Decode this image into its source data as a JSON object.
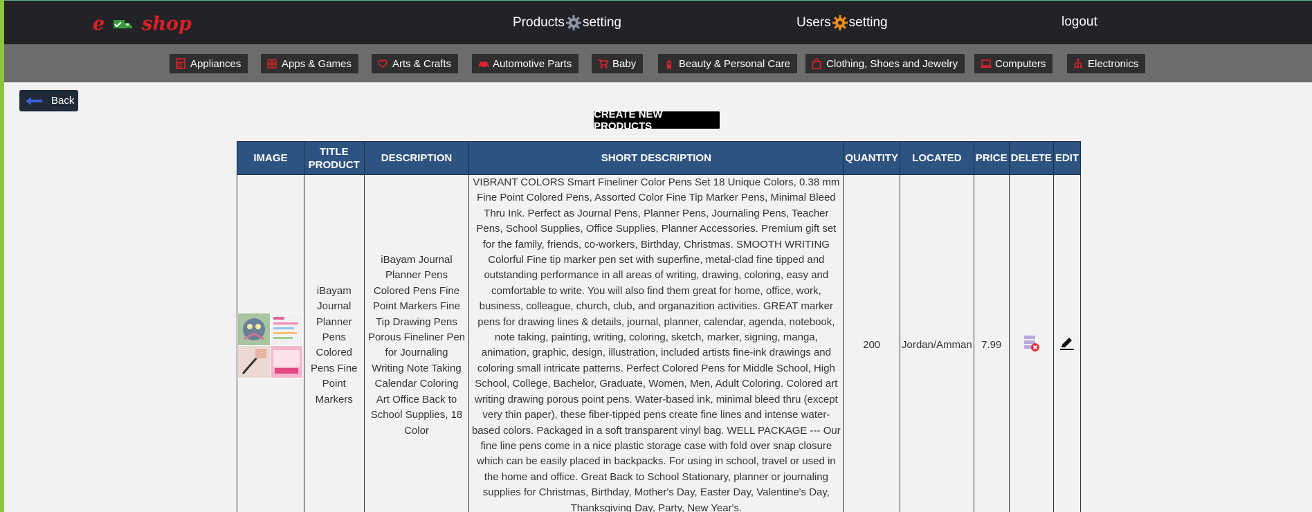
{
  "brand": {
    "left": "e",
    "right": "shop"
  },
  "nav": {
    "products_label_a": "Products",
    "products_label_b": "setting",
    "users_label_a": "Users",
    "users_label_b": "setting",
    "logout_label": "logout"
  },
  "categories": [
    {
      "label": "Appliances",
      "icon": "appliance-icon"
    },
    {
      "label": "Apps & Games",
      "icon": "apps-icon"
    },
    {
      "label": "Arts & Crafts",
      "icon": "heart-hand-icon"
    },
    {
      "label": "Automotive Parts",
      "icon": "car-icon"
    },
    {
      "label": "Baby",
      "icon": "stroller-icon"
    },
    {
      "label": "Beauty & Personal Care",
      "icon": "lipstick-icon"
    },
    {
      "label": "Clothing, Shoes and Jewelry",
      "icon": "bag-icon"
    },
    {
      "label": "Computers",
      "icon": "laptop-icon"
    },
    {
      "label": "Electronics",
      "icon": "circuit-icon"
    }
  ],
  "back_label": "Back",
  "create_title": "CREATE NEW PRODUCTS",
  "table": {
    "headers": {
      "image": "IMAGE",
      "title_a": "TITLE",
      "title_b": "PRODUCT",
      "description": "DESCRIPTION",
      "short_description": "SHORT DESCRIPTION",
      "quantity": "QUANTITY",
      "located": "LOCATED",
      "price": "PRICE",
      "delete": "DELETE",
      "edit": "EDIT"
    },
    "rows": [
      {
        "title": "iBayam Journal Planner Pens Colored Pens Fine Point Markers",
        "description": "iBayam Journal Planner Pens Colored Pens Fine Point Markers Fine Tip Drawing Pens Porous Fineliner Pen for Journaling Writing Note Taking Calendar Coloring Art Office Back to School Supplies, 18 Color",
        "short_description": "VIBRANT COLORS Smart Fineliner Color Pens Set 18 Unique Colors, 0.38 mm Fine Point Colored Pens, Assorted Color Fine Tip Marker Pens, Minimal Bleed Thru Ink. Perfect as Journal Pens, Planner Pens, Journaling Pens, Teacher Pens, School Supplies, Office Supplies, Planner Accessories. Premium gift set for the family, friends, co-workers, Birthday, Christmas. SMOOTH WRITING Colorful Fine tip marker pen set with superfine, metal-clad fine tipped and outstanding performance in all areas of writing, drawing, coloring, easy and comfortable to write. You will also find them great for home, office, work, business, colleague, church, club, and organazition activities. GREAT marker pens for drawing lines & details, journal, planner, calendar, agenda, notebook, note taking, painting, writing, coloring, sketch, marker, signing, manga, animation, graphic, design, illustration, included artists fine-ink drawings and coloring small intricate patterns. Perfect Colored Pens for Middle School, High School, College, Bachelor, Graduate, Women, Men, Adult Coloring. Colored art writing drawing porous point pens. Water-based ink, minimal bleed thru (except very thin paper), these fiber-tipped pens create fine lines and intense water-based colors. Packaged in a soft transparent vinyl bag. WELL PACKAGE --- Our fine line pens come in a nice plastic storage case with fold over snap closure which can be easily placed in backpacks. For using in school, travel or used in the home and office. Great Back to School Stationary, planner or journaling supplies for Christmas, Birthday, Mother's Day, Easter Day, Valentine's Day, Thanksgiving Day, Party, New Year's.",
        "quantity": "200",
        "located": "Jordan/Amman",
        "price": "7.99"
      }
    ]
  },
  "colors": {
    "brand_red": "#d91f26",
    "header_blue": "#2d5380",
    "accent_green": "#8cc63f",
    "gear_gray": "#8a97a6",
    "gear_orange": "#f08c1a"
  }
}
